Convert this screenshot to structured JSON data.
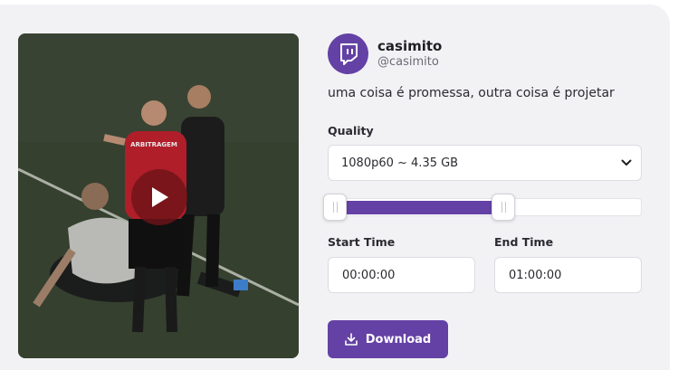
{
  "channel": {
    "name": "casimito",
    "handle": "@casimito",
    "avatar_icon": "twitch-logo-icon",
    "brand_color": "#6441a5"
  },
  "video": {
    "title": "uma coisa é promessa, outra coisa é projetar",
    "shirt_text": "ARBITRAGEM",
    "play_icon": "play-icon"
  },
  "quality": {
    "label": "Quality",
    "selected": "1080p60 ~ 4.35 GB",
    "dropdown_icon": "chevron-down-icon"
  },
  "range": {
    "start_fraction": 0.01,
    "end_fraction": 0.56
  },
  "start_time": {
    "label": "Start Time",
    "value": "00:00:00"
  },
  "end_time": {
    "label": "End Time",
    "value": "01:00:00"
  },
  "download": {
    "label": "Download",
    "icon": "download-icon"
  }
}
